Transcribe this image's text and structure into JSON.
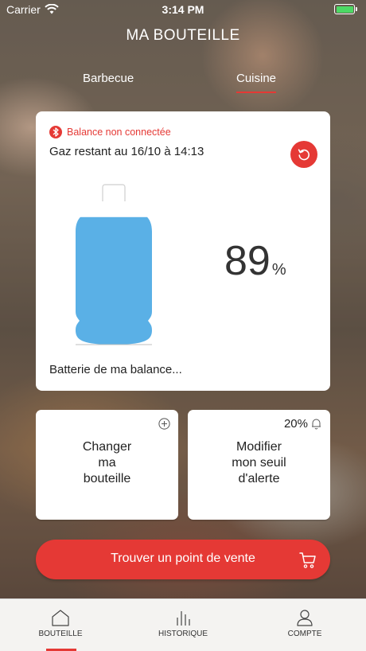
{
  "status_bar": {
    "carrier": "Carrier",
    "time": "3:14 PM",
    "battery_color": "#4cd964"
  },
  "header": {
    "title": "MA BOUTEILLE",
    "tabs": [
      {
        "label": "Barbecue",
        "active": false
      },
      {
        "label": "Cuisine",
        "active": true
      }
    ]
  },
  "gauge_card": {
    "connection_status": "Balance non connectée",
    "gas_label": "Gaz restant au 16/10 à 14:13",
    "percent_value": "89",
    "percent_sign": "%",
    "fill_fraction": 0.89,
    "bottle_color": "#5ab0e6",
    "battery_label": "Batterie de ma balance..."
  },
  "actions": {
    "change_bottle_label": "Changer\nma\nbouteille",
    "alert_threshold_value": "20%",
    "alert_label": "Modifier\nmon seuil\nd'alerte"
  },
  "cta": {
    "label": "Trouver un point de vente"
  },
  "bottom_nav": {
    "items": [
      {
        "label": "BOUTEILLE",
        "icon": "home-icon",
        "active": true
      },
      {
        "label": "HISTORIQUE",
        "icon": "bar-chart-icon",
        "active": false
      },
      {
        "label": "COMPTE",
        "icon": "user-icon",
        "active": false
      }
    ]
  },
  "colors": {
    "accent": "#e53935",
    "card": "#ffffff",
    "nav_background": "#f4f3f1"
  }
}
